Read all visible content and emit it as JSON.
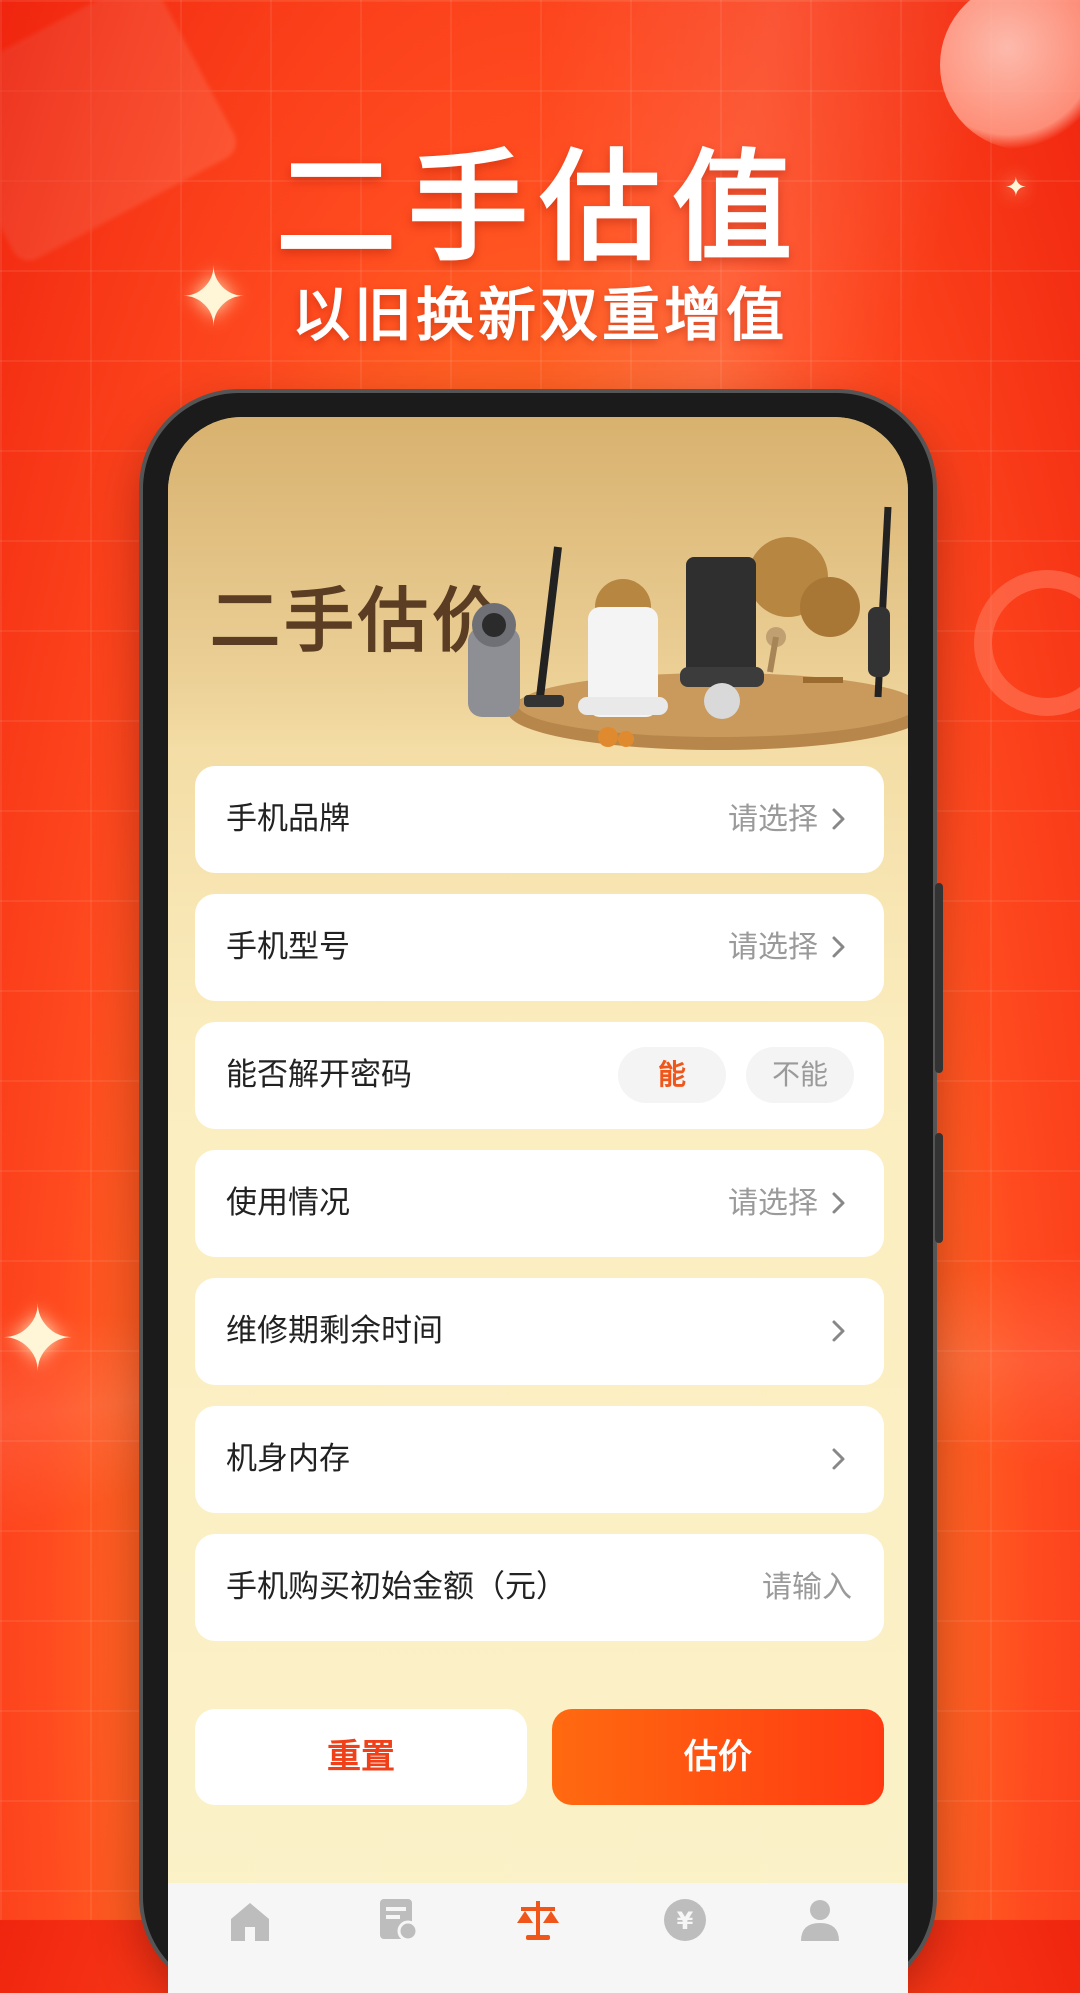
{
  "promo": {
    "title": "二手估值",
    "subtitle": "以旧换新双重增值"
  },
  "banner": {
    "title": "二手估价"
  },
  "form": {
    "rows": [
      {
        "label": "手机品牌",
        "value": "请选择"
      },
      {
        "label": "手机型号",
        "value": "请选择"
      },
      {
        "label": "能否解开密码",
        "options": [
          "能",
          "不能"
        ],
        "selected": "能"
      },
      {
        "label": "使用情况",
        "value": "请选择"
      },
      {
        "label": "维修期剩余时间",
        "value": ""
      },
      {
        "label": "机身内存",
        "value": ""
      },
      {
        "label": "手机购买初始金额（元）",
        "placeholder": "请输入"
      }
    ]
  },
  "actions": {
    "reset_label": "重置",
    "estimate_label": "估价"
  },
  "tabbar": {
    "items": [
      {
        "icon": "home-icon"
      },
      {
        "icon": "document-certificate-icon"
      },
      {
        "icon": "scale-icon",
        "active": true
      },
      {
        "icon": "yen-coin-icon"
      },
      {
        "icon": "user-icon"
      }
    ]
  },
  "colors": {
    "accent": "#ff4a12",
    "background": "#f0250f",
    "screen_bg": "#fbf2c9",
    "text": "#222222",
    "placeholder": "#9a9a9a"
  }
}
